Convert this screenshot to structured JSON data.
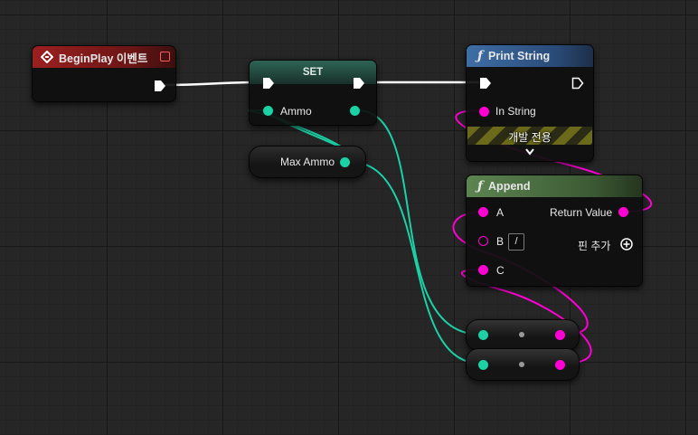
{
  "colors": {
    "exec": "#ffffff",
    "int": "#1bd1a5",
    "string": "#ff00d4",
    "event_header": "#8d1b1b",
    "set_header": "#2d4a42",
    "func_header_blue": "#3a5d8e",
    "func_header_green": "#4d6e43"
  },
  "nodes": {
    "begin_play": {
      "title": "BeginPlay 이벤트",
      "header_icon": "event-diamond-icon",
      "badge_icon": "red-square-icon"
    },
    "set": {
      "title": "SET",
      "pin_label": "Ammo"
    },
    "max_ammo": {
      "label": "Max Ammo"
    },
    "print_string": {
      "title": "Print String",
      "function_icon": "ƒ",
      "in_string_label": "In String",
      "dev_only_label": "개발 전용",
      "expand_icon": "chevron-down-icon"
    },
    "append": {
      "title": "Append",
      "function_icon": "ƒ",
      "pin_a_label": "A",
      "pin_b_label": "B",
      "pin_b_value": "/",
      "pin_c_label": "C",
      "return_label": "Return Value",
      "add_pin_label": "핀 추가",
      "add_pin_icon": "plus-circle-icon"
    },
    "conversion_nodes": [
      {
        "name": "int-to-string-1",
        "dot_icon": "dot-icon"
      },
      {
        "name": "int-to-string-2",
        "dot_icon": "dot-icon"
      }
    ]
  }
}
